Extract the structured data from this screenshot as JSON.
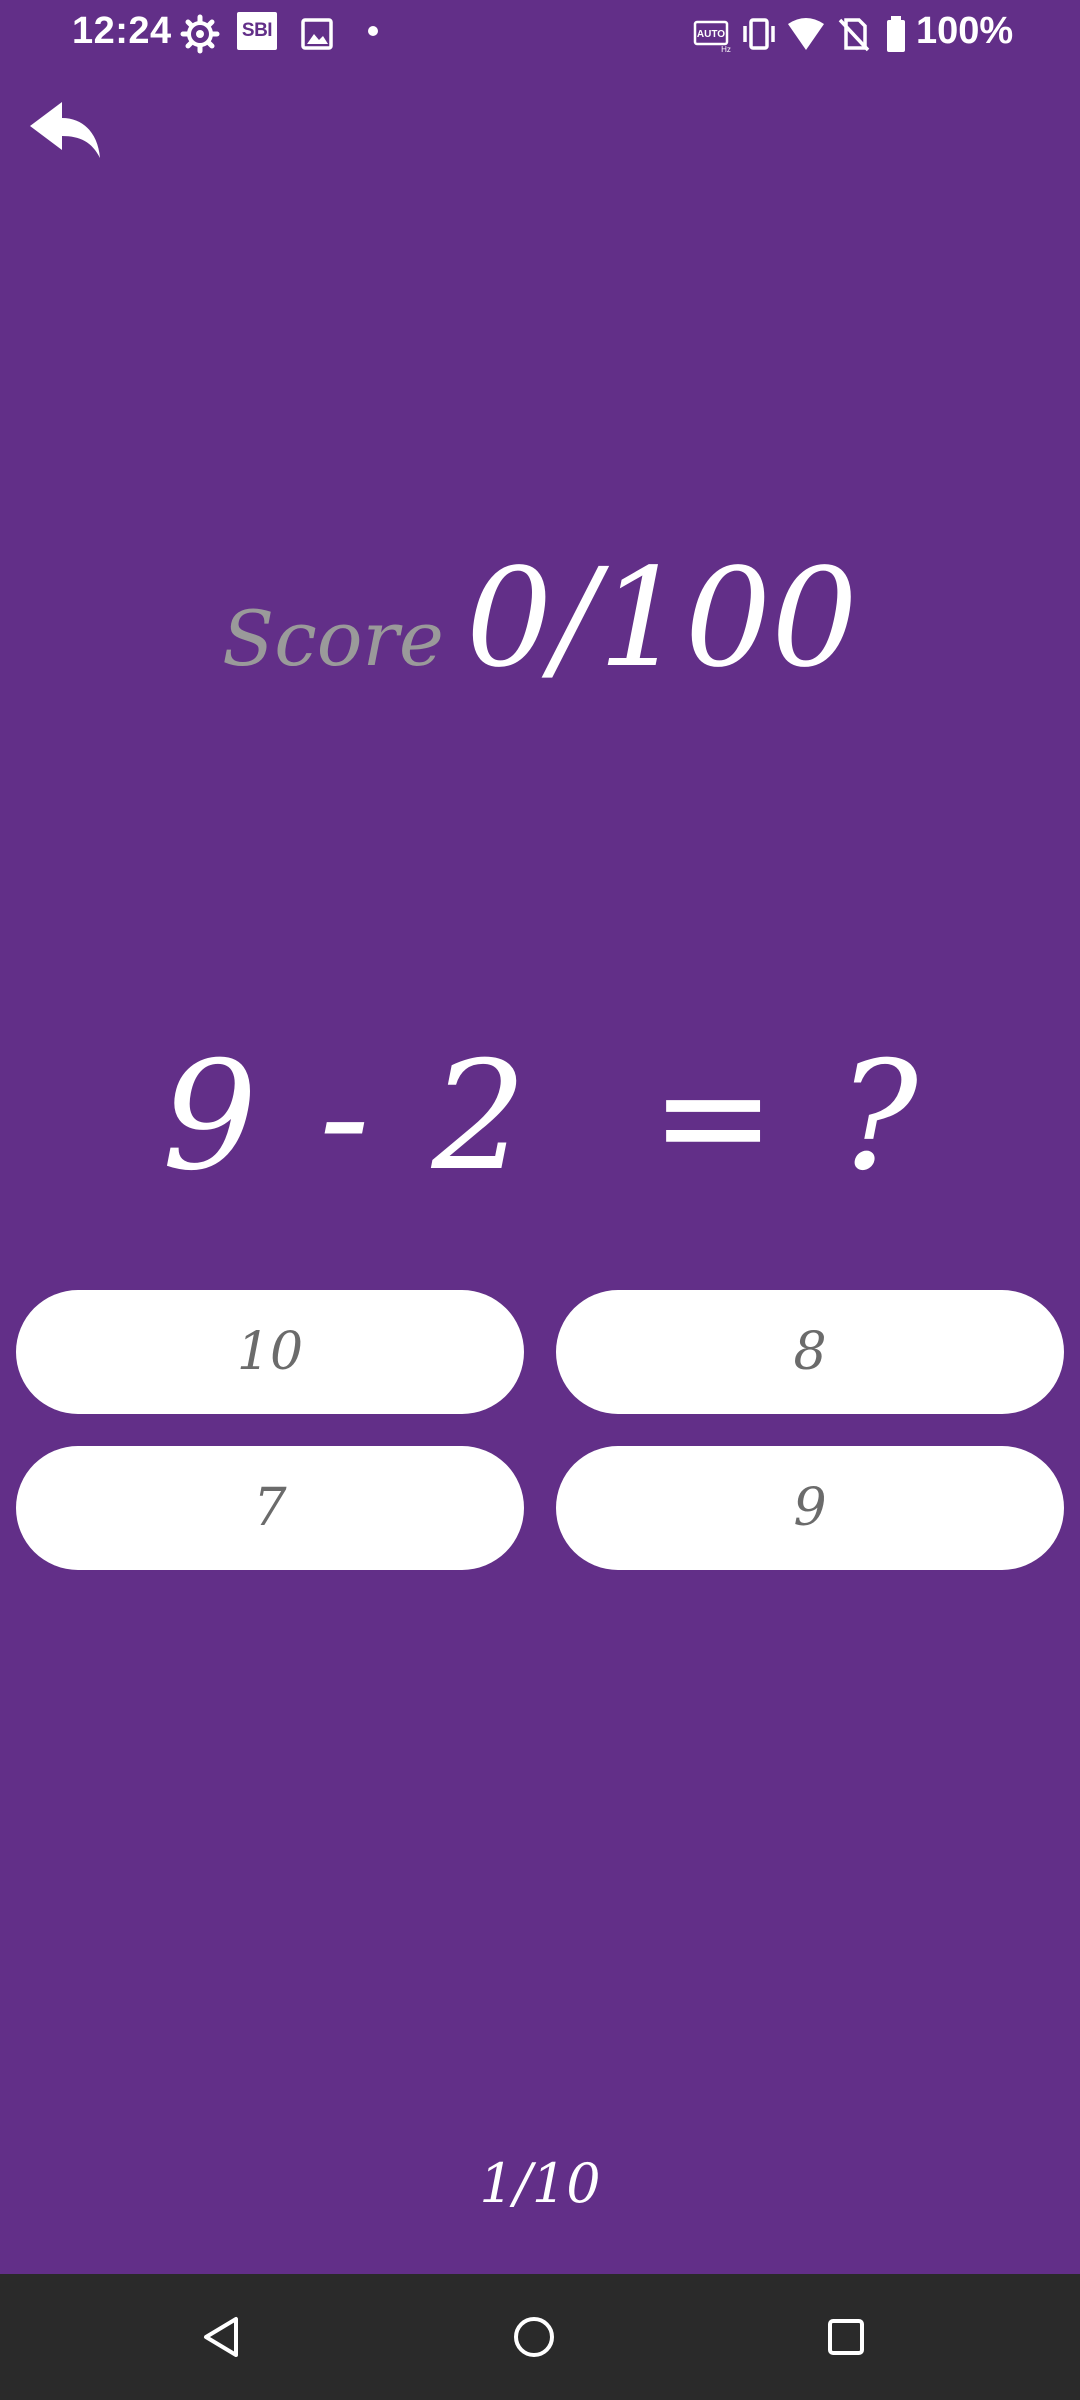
{
  "status_bar": {
    "time": "12:24",
    "badge": "SBI",
    "battery_percent": "100%",
    "icons": [
      "settings-gear-icon",
      "sbi-badge",
      "image-icon",
      "notification-dot",
      "auto-hz-icon",
      "vibrate-icon",
      "wifi-icon",
      "no-sim-icon",
      "battery-icon"
    ]
  },
  "header": {
    "back_icon": "reply-arrow-icon"
  },
  "score": {
    "label": "Score",
    "value": "0/100"
  },
  "question": {
    "text": "9 - 2  = ?"
  },
  "answers": [
    {
      "label": "10"
    },
    {
      "label": "8"
    },
    {
      "label": "7"
    },
    {
      "label": "9"
    }
  ],
  "progress": {
    "text": "1/10"
  },
  "nav_bar": {
    "icons": [
      "back-triangle-icon",
      "home-circle-icon",
      "recents-square-icon"
    ]
  },
  "colors": {
    "background": "#622f88",
    "button": "#ffffff",
    "answer_text": "#6b6b6b",
    "score_label": "#9a9a9a",
    "nav_bar": "#2a2a2a"
  }
}
